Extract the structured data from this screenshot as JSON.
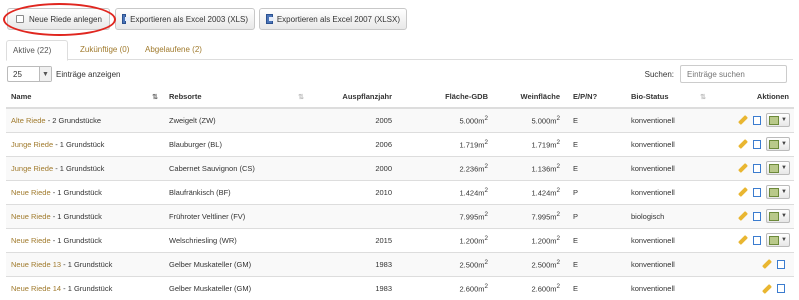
{
  "toolbar": {
    "new_label": "Neue Riede anlegen",
    "xls_label": "Exportieren als Excel 2003 (XLS)",
    "xlsx_label": "Exportieren als Excel 2007 (XLSX)"
  },
  "highlight_color": "#e0261f",
  "tabs": [
    {
      "label": "Aktive (22)"
    },
    {
      "label": "Zukünftige (0)"
    },
    {
      "label": "Abgelaufene (2)"
    }
  ],
  "length": {
    "value": "25",
    "label": "Einträge anzeigen"
  },
  "search": {
    "label": "Suchen:",
    "placeholder": "Einträge suchen"
  },
  "columns": [
    "Name",
    "Rebsorte",
    "Auspflanzjahr",
    "Fläche-GDB",
    "Weinfläche",
    "E/P/N?",
    "Bio-Status",
    "Aktionen"
  ],
  "rows": [
    {
      "link": "Alte Riede",
      "suffix": " - 2 Grundstücke",
      "rebsorte": "Zweigelt (ZW)",
      "jahr": "2005",
      "flaeche": "5.000m",
      "wein": "5.000m",
      "epn": "E",
      "bio": "konventionell",
      "dropdown": true
    },
    {
      "link": "Junge Riede",
      "suffix": " - 1 Grundstück",
      "rebsorte": "Blauburger (BL)",
      "jahr": "2006",
      "flaeche": "1.719m",
      "wein": "1.719m",
      "epn": "E",
      "bio": "konventionell",
      "dropdown": true
    },
    {
      "link": "Junge Riede",
      "suffix": " - 1 Grundstück",
      "rebsorte": "Cabernet Sauvignon (CS)",
      "jahr": "2000",
      "flaeche": "2.236m",
      "wein": "1.136m",
      "epn": "E",
      "bio": "konventionell",
      "dropdown": true
    },
    {
      "link": "Neue Riede",
      "suffix": " - 1 Grundstück",
      "rebsorte": "Blaufränkisch (BF)",
      "jahr": "2010",
      "flaeche": "1.424m",
      "wein": "1.424m",
      "epn": "P",
      "bio": "konventionell",
      "dropdown": true
    },
    {
      "link": "Neue Riede",
      "suffix": " - 1 Grundstück",
      "rebsorte": "Frühroter Veltliner (FV)",
      "jahr": "",
      "flaeche": "7.995m",
      "wein": "7.995m",
      "epn": "P",
      "bio": "biologisch",
      "dropdown": true
    },
    {
      "link": "Neue Riede",
      "suffix": " - 1 Grundstück",
      "rebsorte": "Welschriesling (WR)",
      "jahr": "2015",
      "flaeche": "1.200m",
      "wein": "1.200m",
      "epn": "E",
      "bio": "konventionell",
      "dropdown": true
    },
    {
      "link": "Neue Riede 13",
      "suffix": " - 1 Grundstück",
      "rebsorte": "Gelber Muskateller (GM)",
      "jahr": "1983",
      "flaeche": "2.500m",
      "wein": "2.500m",
      "epn": "E",
      "bio": "konventionell",
      "dropdown": false
    },
    {
      "link": "Neue Riede 14",
      "suffix": " - 1 Grundstück",
      "rebsorte": "Gelber Muskateller (GM)",
      "jahr": "1983",
      "flaeche": "2.600m",
      "wein": "2.600m",
      "epn": "E",
      "bio": "konventionell",
      "dropdown": false
    }
  ],
  "unit_sup": "2",
  "icons": {
    "edit": "pencil-icon",
    "details": "document-icon",
    "menu": "picture-dropdown-icon"
  }
}
